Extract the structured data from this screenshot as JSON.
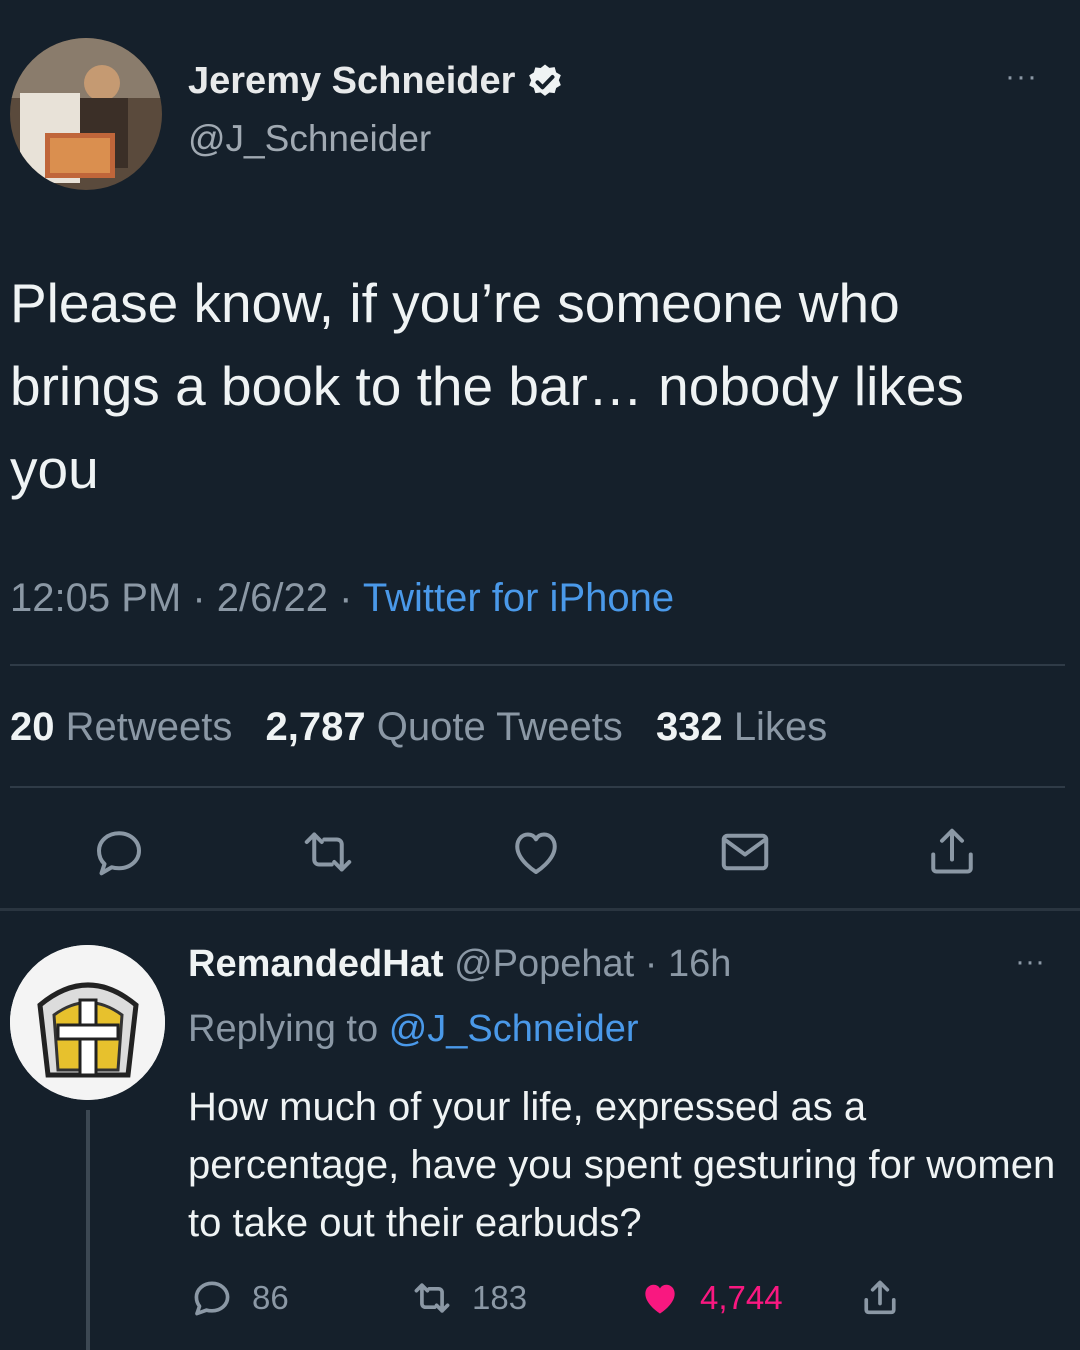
{
  "tweet": {
    "author_name": "Jeremy Schneider",
    "author_handle": "@J_Schneider",
    "text": "Please know, if you’re someone who brings a book to the bar… nobody likes you",
    "time": "12:05 PM",
    "sep1": "·",
    "date": "2/6/22",
    "sep2": "·",
    "source": "Twitter for iPhone",
    "retweets_count": "20",
    "retweets_label": "Retweets",
    "quotes_count": "2,787",
    "quotes_label": "Quote Tweets",
    "likes_count": "332",
    "likes_label": "Likes",
    "more": "···"
  },
  "reply": {
    "author_name": "RemandedHat",
    "author_handle": "@Popehat",
    "sep": "·",
    "age": "16h",
    "replying_prefix": "Replying to",
    "replying_handle": "@J_Schneider",
    "text": "How much of your life, expressed as a percentage, have you spent gesturing for women to take out their earbuds?",
    "reply_count": "86",
    "retweet_count": "183",
    "like_count": "4,744",
    "more": "···"
  },
  "icons": {
    "verified": "verified-badge-icon",
    "reply": "speech-bubble-icon",
    "retweet": "retweet-arrows-icon",
    "like": "heart-icon",
    "dm": "envelope-icon",
    "share": "share-upload-icon"
  },
  "colors": {
    "background": "#15202b",
    "link": "#4a99e9",
    "muted": "#8b98a5",
    "like": "#f91880"
  }
}
